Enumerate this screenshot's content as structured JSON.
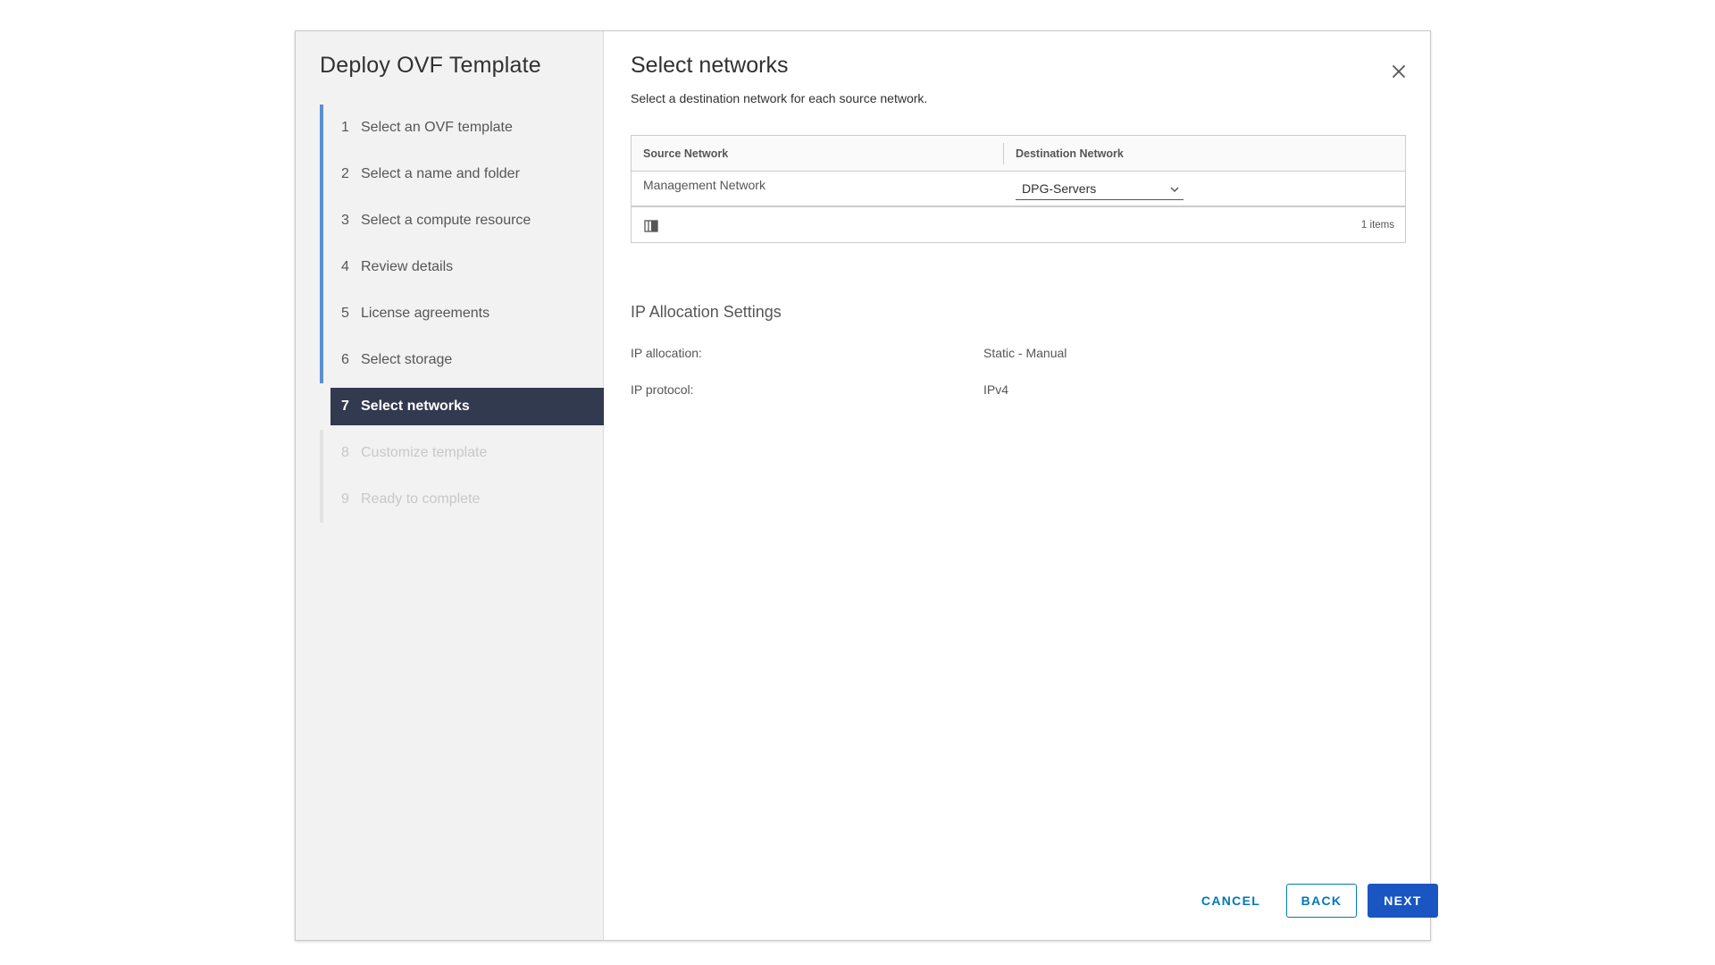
{
  "wizard": {
    "title": "Deploy OVF Template",
    "steps": [
      {
        "num": "1",
        "label": "Select an OVF template",
        "state": "completed"
      },
      {
        "num": "2",
        "label": "Select a name and folder",
        "state": "completed"
      },
      {
        "num": "3",
        "label": "Select a compute resource",
        "state": "completed"
      },
      {
        "num": "4",
        "label": "Review details",
        "state": "completed"
      },
      {
        "num": "5",
        "label": "License agreements",
        "state": "completed"
      },
      {
        "num": "6",
        "label": "Select storage",
        "state": "completed"
      },
      {
        "num": "7",
        "label": "Select networks",
        "state": "active"
      },
      {
        "num": "8",
        "label": "Customize template",
        "state": "disabled"
      },
      {
        "num": "9",
        "label": "Ready to complete",
        "state": "disabled"
      }
    ]
  },
  "page": {
    "title": "Select networks",
    "subtitle": "Select a destination network for each source network.",
    "close_icon": "close-icon"
  },
  "network_grid": {
    "columns": {
      "source": "Source Network",
      "destination": "Destination Network"
    },
    "rows": [
      {
        "source": "Management Network",
        "destination": "DPG-Servers"
      }
    ],
    "footer": {
      "column_toggle_icon": "column-toggle-icon",
      "items_count": "1 items"
    }
  },
  "ip_allocation": {
    "title": "IP Allocation Settings",
    "allocation_label": "IP allocation:",
    "allocation_value": "Static - Manual",
    "protocol_label": "IP protocol:",
    "protocol_value": "IPv4"
  },
  "buttons": {
    "cancel": "CANCEL",
    "back": "BACK",
    "next": "NEXT"
  },
  "colors": {
    "active_step_bg": "#313a4e",
    "step_rail": "#5b8fd1",
    "primary": "#1a56c2",
    "link": "#0079b8"
  }
}
